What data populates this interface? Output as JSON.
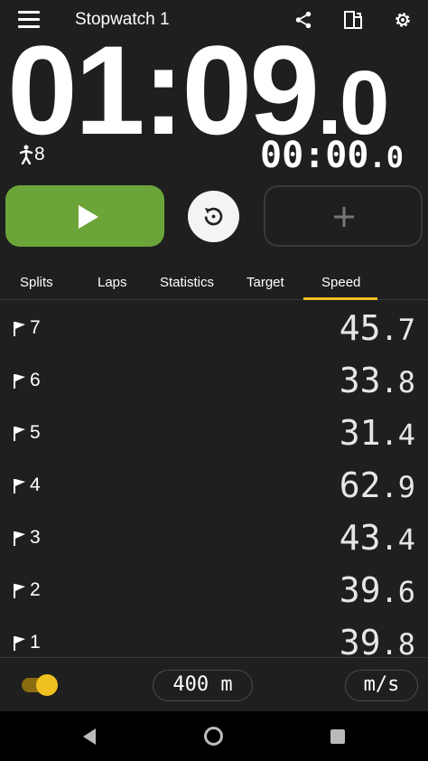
{
  "header": {
    "title": "Stopwatch 1",
    "icons": [
      "menu-icon",
      "share-icon",
      "layout-icon",
      "settings-icon"
    ]
  },
  "timer": {
    "main_int": "01:09",
    "main_dec": ".0",
    "runners": "8",
    "lap_int": "00:00",
    "lap_dec": ".0"
  },
  "tabs": [
    {
      "label": "Splits"
    },
    {
      "label": "Laps"
    },
    {
      "label": "Statistics"
    },
    {
      "label": "Target"
    },
    {
      "label": "Speed",
      "active": true
    }
  ],
  "laps": [
    {
      "num": "7",
      "int": "45",
      "dec": ".7"
    },
    {
      "num": "6",
      "int": "33",
      "dec": ".8"
    },
    {
      "num": "5",
      "int": "31",
      "dec": ".4"
    },
    {
      "num": "4",
      "int": "62",
      "dec": ".9"
    },
    {
      "num": "3",
      "int": "43",
      "dec": ".4"
    },
    {
      "num": "2",
      "int": "39",
      "dec": ".6"
    },
    {
      "num": "1",
      "int": "39",
      "dec": ".8"
    }
  ],
  "footer": {
    "distance": "400 m",
    "unit": "m/s",
    "toggle_on": true
  },
  "colors": {
    "background": "#1f1f1f",
    "start": "#6ba539",
    "accent": "#f0c020"
  }
}
